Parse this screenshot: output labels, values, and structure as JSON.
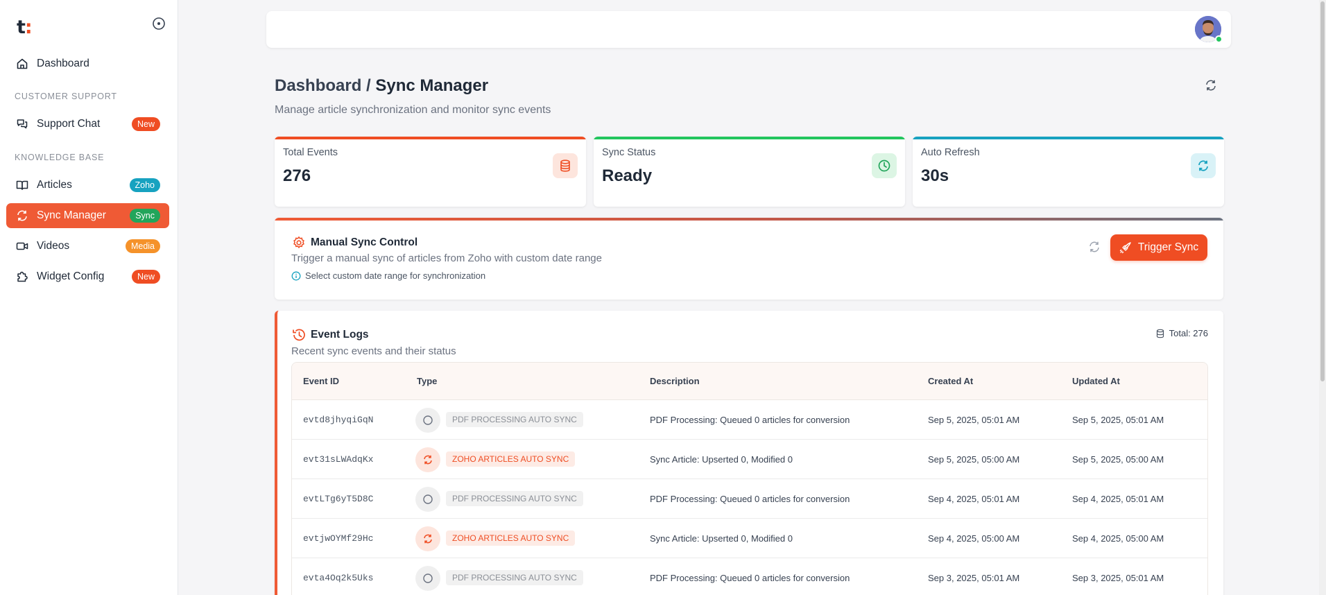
{
  "sidebar": {
    "logo": "t",
    "logo_dot": ":",
    "items": [
      {
        "label": "Dashboard"
      },
      {
        "label": "Support Chat",
        "badge": "New",
        "badge_color": "#ef4d23"
      },
      {
        "label": "Articles",
        "badge": "Zoho",
        "badge_color": "#17a2c0"
      },
      {
        "label": "Sync Manager",
        "badge": "Sync",
        "badge_color": "#22a55b"
      },
      {
        "label": "Videos",
        "badge": "Media",
        "badge_color": "#f5922a"
      },
      {
        "label": "Widget Config",
        "badge": "New",
        "badge_color": "#ef4d23"
      }
    ],
    "sections": {
      "customer_support": "CUSTOMER SUPPORT",
      "knowledge_base": "KNOWLEDGE BASE"
    }
  },
  "header": {
    "breadcrumb_parent": "Dashboard / ",
    "breadcrumb_current": "Sync Manager",
    "subtitle": "Manage article synchronization and monitor sync events"
  },
  "stats": [
    {
      "label": "Total Events",
      "value": "276",
      "icon": "database-icon",
      "color": "#ef4d23"
    },
    {
      "label": "Sync Status",
      "value": "Ready",
      "icon": "clock-icon",
      "color": "#22c55e"
    },
    {
      "label": "Auto Refresh",
      "value": "30s",
      "icon": "refresh-icon",
      "color": "#17a2c0"
    }
  ],
  "manual_sync": {
    "title": "Manual Sync Control",
    "description": "Trigger a manual sync of articles from Zoho with custom date range",
    "hint": "Select custom date range for synchronization",
    "button_label": "Trigger Sync"
  },
  "event_logs": {
    "title": "Event Logs",
    "description": "Recent sync events and their status",
    "total_label": "Total: 276",
    "columns": [
      "Event ID",
      "Type",
      "Description",
      "Created At",
      "Updated At"
    ],
    "rows": [
      {
        "id": "evtd8jhyqiGqN",
        "type": "PDF PROCESSING AUTO SYNC",
        "kind": "pdf",
        "description": "PDF Processing: Queued 0 articles for conversion",
        "created": "Sep 5, 2025, 05:01 AM",
        "updated": "Sep 5, 2025, 05:01 AM"
      },
      {
        "id": "evt31sLWAdqKx",
        "type": "ZOHO ARTICLES AUTO SYNC",
        "kind": "zoho",
        "description": "Sync Article: Upserted 0, Modified 0",
        "created": "Sep 5, 2025, 05:00 AM",
        "updated": "Sep 5, 2025, 05:00 AM"
      },
      {
        "id": "evtLTg6yT5D8C",
        "type": "PDF PROCESSING AUTO SYNC",
        "kind": "pdf",
        "description": "PDF Processing: Queued 0 articles for conversion",
        "created": "Sep 4, 2025, 05:01 AM",
        "updated": "Sep 4, 2025, 05:01 AM"
      },
      {
        "id": "evtjwOYMf29Hc",
        "type": "ZOHO ARTICLES AUTO SYNC",
        "kind": "zoho",
        "description": "Sync Article: Upserted 0, Modified 0",
        "created": "Sep 4, 2025, 05:00 AM",
        "updated": "Sep 4, 2025, 05:00 AM"
      },
      {
        "id": "evta4Oq2k5Uks",
        "type": "PDF PROCESSING AUTO SYNC",
        "kind": "pdf",
        "description": "PDF Processing: Queued 0 articles for conversion",
        "created": "Sep 3, 2025, 05:01 AM",
        "updated": "Sep 3, 2025, 05:01 AM"
      }
    ]
  },
  "colors": {
    "accent": "#ef4d23",
    "active_nav": "#ef5a35",
    "success": "#22c55e",
    "info": "#17a2c0"
  }
}
